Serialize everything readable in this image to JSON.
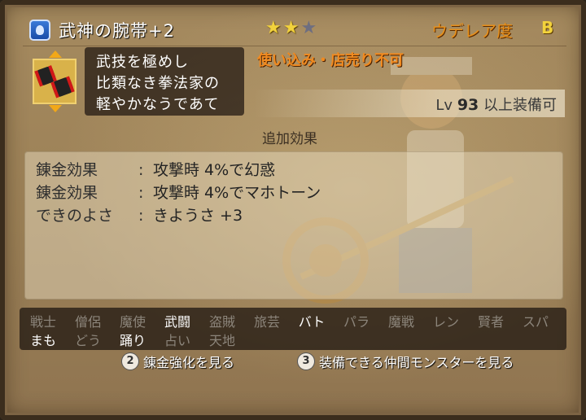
{
  "header": {
    "item_name": "武神の腕帯+2",
    "stars_filled": 2,
    "stars_total": 3,
    "rarity_label": "ウデレア度",
    "rarity_value": "B"
  },
  "item": {
    "icon": "red-black-wristband-icon",
    "description": [
      "武技を極めし",
      "比類なき拳法家の",
      "軽やかなうであて"
    ],
    "restriction": "使い込み・店売り不可",
    "level_prefix": "Lv",
    "level_value": "93",
    "level_suffix": "以上装備可"
  },
  "effects": {
    "title": "追加効果",
    "rows": [
      {
        "key": "錬金効果",
        "sep": ":",
        "value": "攻撃時 4%で幻惑"
      },
      {
        "key": "錬金効果",
        "sep": ":",
        "value": "攻撃時 4%でマホトーン"
      },
      {
        "key": "できのよさ",
        "sep": ":",
        "value": "きようさ +3"
      }
    ]
  },
  "jobs": {
    "row1": [
      {
        "name": "戦士",
        "on": false
      },
      {
        "name": "僧侶",
        "on": false
      },
      {
        "name": "魔使",
        "on": false
      },
      {
        "name": "武闘",
        "on": true
      },
      {
        "name": "盗賊",
        "on": false
      },
      {
        "name": "旅芸",
        "on": false
      },
      {
        "name": "バト",
        "on": true
      },
      {
        "name": "パラ",
        "on": false
      },
      {
        "name": "魔戦",
        "on": false
      },
      {
        "name": "レン",
        "on": false
      },
      {
        "name": "賢者",
        "on": false
      },
      {
        "name": "スパ",
        "on": false
      }
    ],
    "row2": [
      {
        "name": "まも",
        "on": true
      },
      {
        "name": "どう",
        "on": false
      },
      {
        "name": "踊り",
        "on": true
      },
      {
        "name": "占い",
        "on": false
      },
      {
        "name": "天地",
        "on": false
      }
    ]
  },
  "footer": {
    "btn1_number": "2",
    "btn1_label": "錬金強化を見る",
    "btn2_number": "3",
    "btn2_label": "装備できる仲間モンスターを見る"
  },
  "colors": {
    "rarity": "#e8901a",
    "restriction": "#f08a20",
    "job_active": "#ffffff",
    "job_inactive": "#8c857b"
  }
}
